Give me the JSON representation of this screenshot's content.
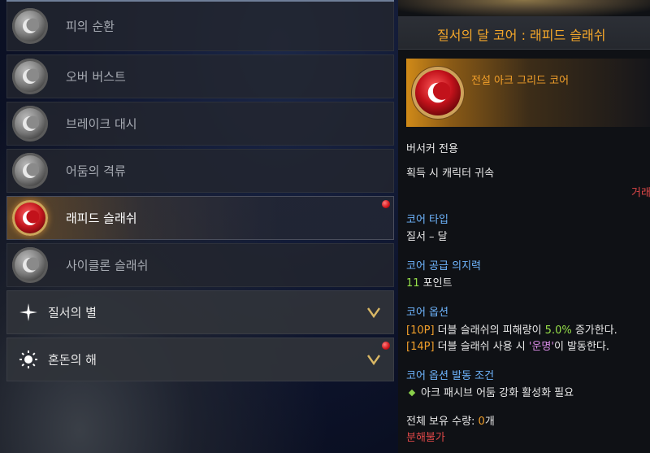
{
  "left_list": {
    "items": [
      {
        "label": "피의 순환",
        "state": "inactive"
      },
      {
        "label": "오버 버스트",
        "state": "inactive"
      },
      {
        "label": "브레이크 대시",
        "state": "inactive"
      },
      {
        "label": "어둠의 격류",
        "state": "inactive"
      },
      {
        "label": "래피드 슬래쉬",
        "state": "selected",
        "badge": "red-dot"
      },
      {
        "label": "사이클론 슬래쉬",
        "state": "inactive"
      }
    ],
    "sections": [
      {
        "label": "질서의 별",
        "icon": "star-icon"
      },
      {
        "label": "혼돈의 해",
        "icon": "sun-icon",
        "badge": "red-dot"
      }
    ]
  },
  "tooltip": {
    "title": "질서의 달 코어 : 래피드 슬래쉬",
    "grade": "전설 아크 그리드 코어",
    "class_only": "버서커 전용",
    "bind": "획득 시 캐릭터 귀속",
    "trade_partial": "거래",
    "core_type_label": "코어 타입",
    "core_type_value": "질서 – 달",
    "willpower_label": "코어 공급 의지력",
    "willpower_value": "11",
    "willpower_unit": " 포인트",
    "options_label": "코어 옵션",
    "option1": {
      "tag": "[10P]",
      "pre": " 더블 슬래쉬의 피해량이 ",
      "value": "5.0%",
      "post": " 증가한다."
    },
    "option2": {
      "tag": "[14P]",
      "pre": " 더블 슬래쉬 사용 시 ",
      "value": "'운명'",
      "post": "이 발동한다."
    },
    "condition_label": "코어 옵션 발동 조건",
    "condition_text": "아크 패시브 어둠 강화 활성화 필요",
    "owned_label": "전체 보유 수량: ",
    "owned_value": "0",
    "owned_unit": "개",
    "disassemble": "분해불가"
  },
  "colors": {
    "accent_orange": "#f3a02a",
    "section_blue": "#6fb6ff",
    "value_green": "#97e04a",
    "fate_purple": "#d98be6",
    "warning_red": "#e04848"
  }
}
